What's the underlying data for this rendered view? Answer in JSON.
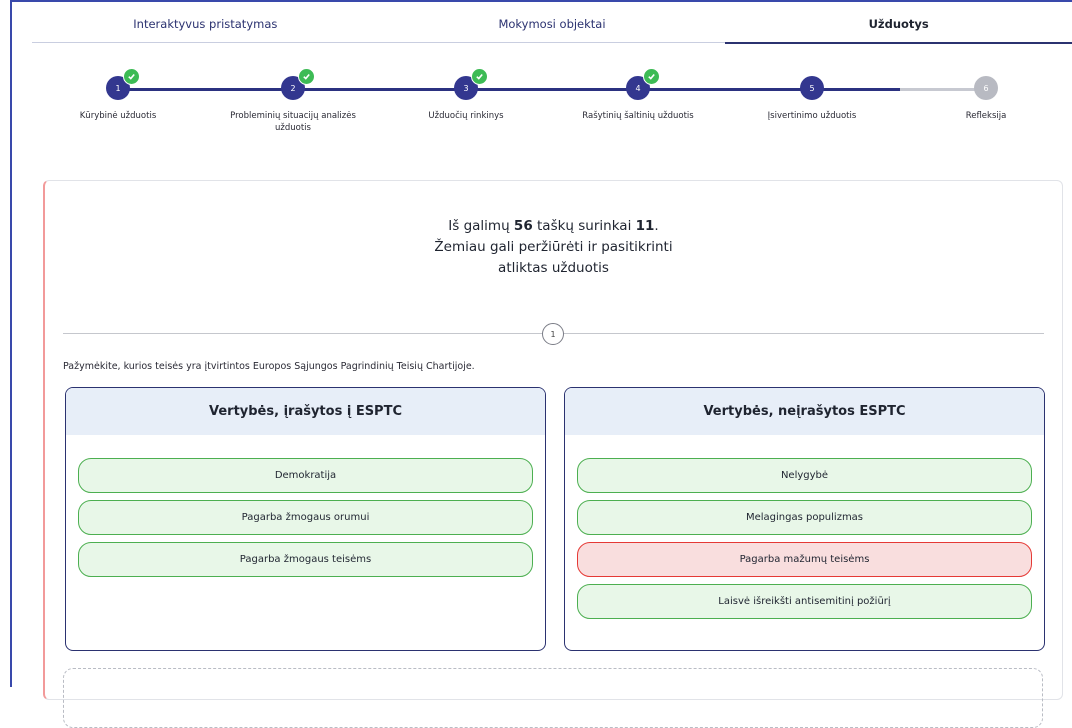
{
  "tabs": [
    {
      "label": "Interaktyvus pristatymas",
      "active": false
    },
    {
      "label": "Mokymosi objektai",
      "active": false
    },
    {
      "label": "Užduotys",
      "active": true
    }
  ],
  "steps": [
    {
      "number": "1",
      "label": "Kūrybinė užduotis",
      "completed": true
    },
    {
      "number": "2",
      "label": "Probleminių situacijų analizės užduotis",
      "completed": true
    },
    {
      "number": "3",
      "label": "Užduočių rinkinys",
      "completed": true
    },
    {
      "number": "4",
      "label": "Rašytinių šaltinių užduotis",
      "completed": true
    },
    {
      "number": "5",
      "label": "Įsivertinimo užduotis",
      "completed": false,
      "current": true
    },
    {
      "number": "6",
      "label": "Refleksija",
      "completed": false
    }
  ],
  "result": {
    "prefix": "Iš galimų ",
    "max_points": "56",
    "middle": " taškų surinkai ",
    "points": "11",
    "suffix": ".",
    "line2": "Žemiau gali peržiūrėti ir pasitikrinti",
    "line3": "atliktas užduotis"
  },
  "question": {
    "number": "1",
    "text": "Pažymėkite, kurios teisės yra įtvirtintos Europos Sąjungos Pagrindinių Teisių Chartijoje."
  },
  "columns": [
    {
      "title": "Vertybės, įrašytos į ESPTC",
      "items": [
        {
          "label": "Demokratija",
          "status": "correct"
        },
        {
          "label": "Pagarba žmogaus orumui",
          "status": "correct"
        },
        {
          "label": "Pagarba žmogaus teisėms",
          "status": "correct"
        }
      ]
    },
    {
      "title": "Vertybės, neįrašytos ESPTC",
      "items": [
        {
          "label": "Nelygybė",
          "status": "correct"
        },
        {
          "label": "Melagingas populizmas",
          "status": "correct"
        },
        {
          "label": "Pagarba mažumų teisėms",
          "status": "wrong"
        },
        {
          "label": "Laisvė išreikšti antisemitinį požiūrį",
          "status": "correct"
        }
      ]
    }
  ],
  "colors": {
    "primary": "#33378f",
    "pending": "#b8bac2",
    "check": "#3dbb55",
    "correct_border": "#4caf50",
    "correct_bg": "#e8f7e8",
    "wrong_border": "#e53935",
    "wrong_bg": "#f9dede",
    "column_header_bg": "#e7eef8",
    "card_accent": "#f29a9a"
  }
}
